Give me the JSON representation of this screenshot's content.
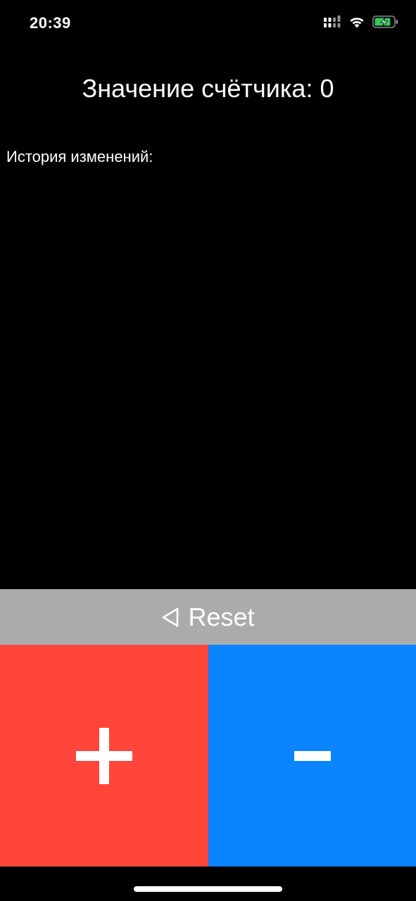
{
  "status_bar": {
    "time": "20:39"
  },
  "counter": {
    "title": "Значение счётчика: 0"
  },
  "history": {
    "label": "История изменений:"
  },
  "controls": {
    "reset_label": "Reset",
    "colors": {
      "reset_bg": "#ababab",
      "plus_bg": "#ff453a",
      "minus_bg": "#0a84ff",
      "battery_fill": "#34c759"
    }
  }
}
